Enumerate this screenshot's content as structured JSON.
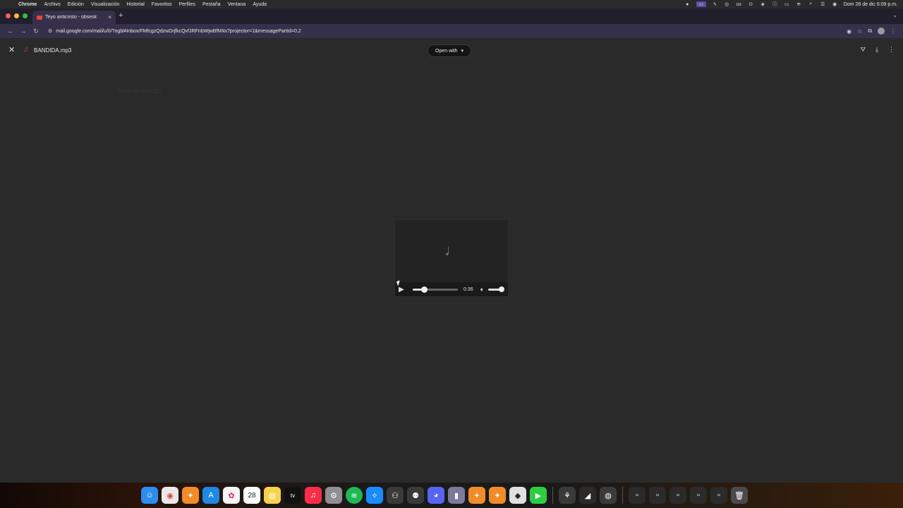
{
  "menubar": {
    "app": "Chrome",
    "items": [
      "Archivo",
      "Edición",
      "Visualización",
      "Historial",
      "Favoritos",
      "Perfiles",
      "Pestaña",
      "Ventana",
      "Ayuda"
    ],
    "status_lang": "us",
    "clock": "Dom 28 de dic 6:09 p.m."
  },
  "tab": {
    "title": "Teyo anticristo - obsesk",
    "close": "×",
    "new_tab": "+"
  },
  "toolbar": {
    "url": "mail.google.com/mail/u/0/?ogbl#inbox/FMfcgzQdzwDrjfkcQvfJRFnbWjwBfNNx?projector=1&messagePartId=0.2"
  },
  "viewer": {
    "file_name": "BANDIDA.mp3",
    "open_with": "Open with",
    "close": "✕",
    "background_subject": "Teyo anticristo"
  },
  "player": {
    "time": "0:36",
    "progress_fraction": 0.25,
    "volume_fraction": 1.0
  },
  "dock": {
    "icons": [
      "finder-icon",
      "chrome-icon",
      "fl-studio-icon",
      "appstore-icon",
      "photos-icon",
      "calendar-icon",
      "notes-icon",
      "appletv-icon",
      "music-icon",
      "settings-icon",
      "spotify-icon",
      "safari-icon",
      "utility-icon",
      "utility-icon-2",
      "discord-icon",
      "app-icon",
      "fl-studio-icon-2",
      "fl-studio-icon-3",
      "roblox-icon",
      "facetime-icon",
      "tool-icon",
      "tool-icon-2",
      "vpn-icon",
      "recent-app-1",
      "recent-app-2",
      "recent-app-3",
      "recent-app-4",
      "recent-app-5",
      "trash-icon"
    ],
    "calendar_day": "28",
    "tv_label": "tv"
  }
}
